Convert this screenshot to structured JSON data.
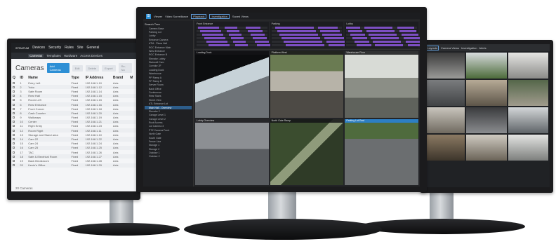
{
  "left_monitor": {
    "nav": {
      "logo": "STRATUM",
      "items": [
        "Devices",
        "Security",
        "Rules",
        "Site",
        "General"
      ]
    },
    "subnav": {
      "items": [
        "Cameras",
        "Templates",
        "Hardware",
        "Access Devices"
      ],
      "active": "Cameras"
    },
    "title": "Cameras",
    "buttons": {
      "add": "Add Cameras",
      "edit": "Edit",
      "delete": "Delete",
      "export": "Export",
      "more": "Re-Nu"
    },
    "columns": [
      "Q",
      "ID",
      "Name",
      "Type",
      "IP Address",
      "Brand",
      "M"
    ],
    "rows": [
      [
        "1",
        "Entry Left",
        "Fixed",
        "192.168.1.10",
        "Axis"
      ],
      [
        "2",
        "Yoko",
        "Fixed",
        "192.168.1.12",
        "Axis"
      ],
      [
        "3",
        "Safe Room",
        "Fixed",
        "192.168.1.14",
        "Axis"
      ],
      [
        "4",
        "Rear Hall",
        "Fixed",
        "192.168.1.15",
        "Axis"
      ],
      [
        "5",
        "Room Left",
        "Fixed",
        "192.168.1.15",
        "Axis"
      ],
      [
        "6",
        "Rear Entrance",
        "Fixed",
        "192.168.1.16",
        "Axis"
      ],
      [
        "7",
        "Front Corner",
        "Fixed",
        "192.168.1.18",
        "Axis"
      ],
      [
        "8",
        "Cash Counter",
        "Fixed",
        "192.168.1.20",
        "Axis"
      ],
      [
        "9",
        "Walkways",
        "Fixed",
        "192.168.1.19",
        "Axis"
      ],
      [
        "10",
        "Center",
        "Fixed",
        "192.168.1.21",
        "Axis"
      ],
      [
        "11",
        "Right Entry",
        "Fixed",
        "192.168.1.23",
        "Axis"
      ],
      [
        "12",
        "Room Right",
        "Fixed",
        "192.168.1.11",
        "Axis"
      ],
      [
        "13",
        "Storage and Stand area",
        "Fixed",
        "192.168.1.10",
        "Axis"
      ],
      [
        "14",
        "Cam 22",
        "Fixed",
        "192.168.1.22",
        "Axis"
      ],
      [
        "15",
        "Cam 24",
        "Fixed",
        "192.168.1.24",
        "Axis"
      ],
      [
        "16",
        "Cam 25",
        "Fixed",
        "192.168.1.25",
        "Axis"
      ],
      [
        "17",
        "TAC",
        "Fixed",
        "192.168.1.26",
        "Axis"
      ],
      [
        "18",
        "Safe & Electrical Room",
        "Fixed",
        "192.168.1.27",
        "Axis"
      ],
      [
        "19",
        "Back Breakroom",
        "Fixed",
        "192.168.1.28",
        "Axis"
      ],
      [
        "20",
        "Kevin's Office",
        "Fixed",
        "192.168.1.29",
        "Axis"
      ]
    ],
    "footer": "20 Cameras"
  },
  "center_monitor": {
    "topbar": [
      "Viewer",
      "Video Surveillance",
      "Playback",
      "Investigation",
      "Saved Views"
    ],
    "sidebar_header": "Search Tree",
    "sidebar_items": [
      "Camera Base",
      "Parking Lot",
      "Lobby",
      "Entrance Camera",
      "ATM - Plaza Hall",
      "ROC Entrance Main",
      "West Entrance",
      "ROC Entrance B",
      "Elevator Lobby",
      "Stairwell Cam",
      "Corridor 2F",
      "Loading Dock",
      "Warehouse",
      "PP Ramp A",
      "PP Ramp B",
      "Server Room",
      "Back Office",
      "Conference",
      "Rear Stairs",
      "Street View",
      "ATL Entrance Lot",
      "Main Hall - Overview",
      "Elevator 2",
      "Garage Level 1",
      "Garage Level 2",
      "Roof Access",
      "Lot Camera 3",
      "PTZ Camera Front",
      "North Gate",
      "South Gate",
      "Fence Line",
      "Storage 1",
      "Storage 2",
      "Outdoor 1",
      "Outdoor 2"
    ],
    "selected_item": "Main Hall - Overview",
    "timelines": [
      "Front Entrance",
      "Parking",
      "Lobby"
    ],
    "cameras": [
      {
        "caption": "Loading Dock",
        "highlight": false
      },
      {
        "caption": "Platform West",
        "highlight": false
      },
      {
        "caption": "Warehouse Floor",
        "highlight": false
      },
      {
        "caption": "Lobby Overview",
        "highlight": false
      },
      {
        "caption": "North Gate Ramp",
        "highlight": false
      },
      {
        "caption": "Parking Lot East",
        "highlight": true
      }
    ],
    "colors": {
      "accent": "#2d8fd5",
      "timeline": "#7d4fc4"
    }
  },
  "right_monitor": {
    "topbar": [
      "Layouts",
      "Camera Views",
      "Investigation",
      "Alerts"
    ],
    "cell_count": 12
  }
}
